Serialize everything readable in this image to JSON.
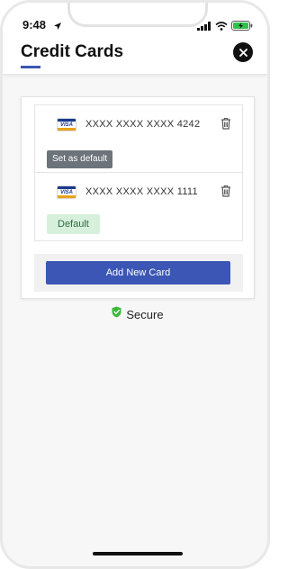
{
  "status_bar": {
    "time": "9:48"
  },
  "header": {
    "title": "Credit Cards",
    "accent_color": "#3b56b4"
  },
  "cards": [
    {
      "brand": "VISA",
      "number": "XXXX XXXX XXXX 4242",
      "action_label": "Set as default"
    },
    {
      "brand": "VISA",
      "number": "XXXX XXXX XXXX 1111",
      "badge_label": "Default"
    }
  ],
  "add_card": {
    "label": "Add New Card"
  },
  "secure": {
    "label": "Secure",
    "icon": "shield-check-icon",
    "icon_color": "#3cba3c"
  }
}
